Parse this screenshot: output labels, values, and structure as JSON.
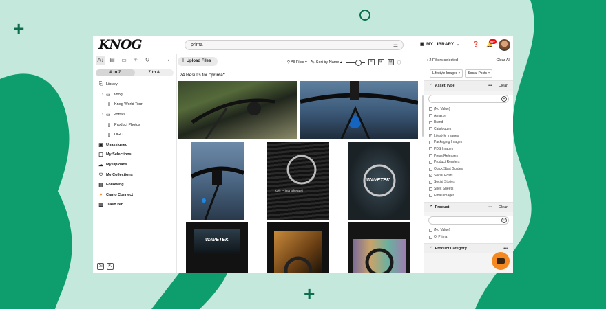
{
  "brand": {
    "logo": "KNOG",
    "accent": "#f5891f"
  },
  "header": {
    "search_value": "prima",
    "library_label": "MY LIBRARY",
    "badge": "99+",
    "icons": [
      "filter-icon",
      "library-icon",
      "help-icon",
      "bell-icon"
    ]
  },
  "sidebar": {
    "sort": {
      "az": "A to Z",
      "za": "Z to A",
      "selected": "A to Z"
    },
    "items": [
      {
        "label": "Library",
        "bold": false,
        "indent": 0,
        "icon": "library-icon"
      },
      {
        "label": "Knog",
        "bold": false,
        "indent": 1,
        "icon": "folder-icon",
        "chevron": true
      },
      {
        "label": "Knog World Tour",
        "bold": false,
        "indent": 2,
        "icon": "album-icon"
      },
      {
        "label": "Portals",
        "bold": false,
        "indent": 1,
        "icon": "folder-icon",
        "chevron": true
      },
      {
        "label": "Product Photos",
        "bold": false,
        "indent": 2,
        "icon": "album-icon"
      },
      {
        "label": "UGC",
        "bold": false,
        "indent": 2,
        "icon": "album-icon"
      },
      {
        "label": "Unassigned",
        "bold": true,
        "indent": 0,
        "icon": "unassigned-icon"
      },
      {
        "label": "My Selections",
        "bold": true,
        "indent": 0,
        "icon": "selections-icon"
      },
      {
        "label": "My Uploads",
        "bold": true,
        "indent": 0,
        "icon": "upload-cloud-icon"
      },
      {
        "label": "My Collections",
        "bold": true,
        "indent": 0,
        "icon": "heart-icon"
      },
      {
        "label": "Following",
        "bold": true,
        "indent": 0,
        "icon": "following-icon"
      },
      {
        "label": "Canto Connect",
        "bold": true,
        "indent": 0,
        "icon": "canto-icon"
      },
      {
        "label": "Trash Bin",
        "bold": true,
        "indent": 0,
        "icon": "trash-icon"
      }
    ]
  },
  "main": {
    "upload_label": "Upload Files",
    "all_files": "All Files",
    "sort_label": "Sort by Name",
    "results_prefix": "24 Results for",
    "results_query": "\"prima\""
  },
  "filters": {
    "selected_label": "2 Filters selected",
    "clear_all": "Clear All",
    "chips": [
      "Lifestyle Images",
      "Social Posts"
    ],
    "asset_type": {
      "title": "Asset Type",
      "clear": "Clear",
      "more": "•••",
      "options": [
        {
          "label": "(No Value)",
          "checked": false
        },
        {
          "label": "Amazon",
          "checked": false
        },
        {
          "label": "Brand",
          "checked": false
        },
        {
          "label": "Catalogues",
          "checked": false
        },
        {
          "label": "Lifestyle Images",
          "checked": true
        },
        {
          "label": "Packaging Images",
          "checked": false
        },
        {
          "label": "PDS Images",
          "checked": false
        },
        {
          "label": "Press Releases",
          "checked": false
        },
        {
          "label": "Product Renders",
          "checked": false
        },
        {
          "label": "Quick Start Guides",
          "checked": false
        },
        {
          "label": "Social Posts",
          "checked": true
        },
        {
          "label": "Social Stories",
          "checked": false
        },
        {
          "label": "Spec Sheets",
          "checked": false
        },
        {
          "label": "Email Images",
          "checked": false
        }
      ]
    },
    "product": {
      "title": "Product",
      "clear": "Clear",
      "more": "•••",
      "options": [
        {
          "label": "(No Value)",
          "checked": false
        },
        {
          "label": "Oi Prima",
          "checked": false
        }
      ]
    },
    "product_category": {
      "title": "Product Category",
      "more": "•••"
    }
  },
  "thumbnails": [
    {
      "label": ""
    },
    {
      "label": ""
    },
    {
      "label": ""
    },
    {
      "label": "Oi® Prima Bike Bell"
    },
    {
      "label": "WAVETEK"
    },
    {
      "label": "WAVETEK"
    },
    {
      "label": ""
    },
    {
      "label": ""
    }
  ]
}
